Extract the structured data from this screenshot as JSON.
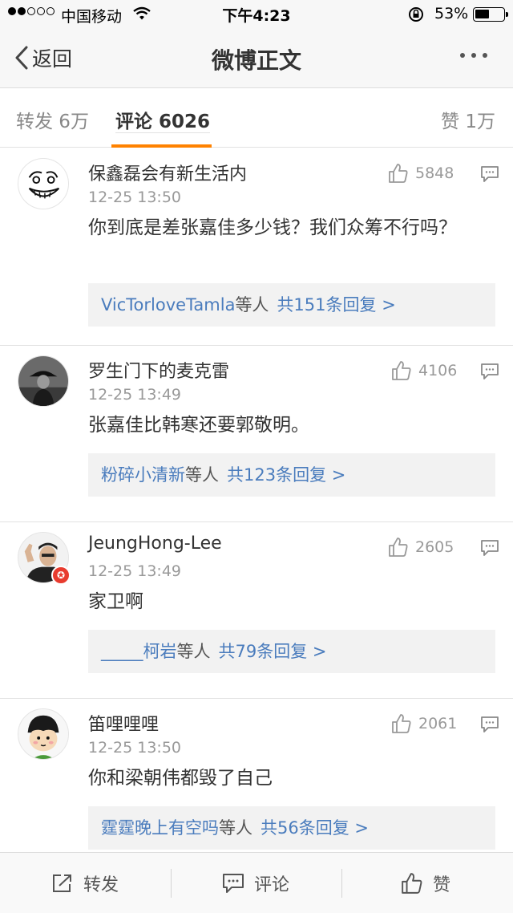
{
  "status_bar": {
    "carrier": "中国移动",
    "time": "下午4:23",
    "battery_percent_text": "53%",
    "battery_level": 0.53,
    "signal_bars_filled": 2,
    "signal_bars_total": 5
  },
  "nav": {
    "back_label": "返回",
    "title": "微博正文"
  },
  "tabs": {
    "repost": "转发 6万",
    "comment": "评论 6026",
    "like": "赞 1万",
    "accent_color": "#ff8200"
  },
  "comments": [
    {
      "username": "保鑫磊会有新生活内",
      "time": "12-25 13:50",
      "likes": "5848",
      "text": "你到底是差张嘉佳多少钱？我们众筹不行吗？",
      "reply_names": "VicTorloveTamla",
      "reply_mid": "等人",
      "reply_count": "共151条回复 >",
      "avatar_icon": "rage-face-avatar"
    },
    {
      "username": "罗生门下的麦克雷",
      "time": "12-25 13:49",
      "likes": "4106",
      "text": "张嘉佳比韩寒还要郭敬明。",
      "reply_names": "粉碎小清新",
      "reply_mid": "等人",
      "reply_count": "共123条回复 >",
      "avatar_icon": "cowboy-avatar"
    },
    {
      "username": "JeungHong-Lee",
      "time": "12-25 13:49",
      "likes": "2605",
      "text": "家卫啊",
      "reply_names": "_____柯岩",
      "reply_mid": "等人",
      "reply_count": "共79条回复 >",
      "avatar_icon": "person-thumb-avatar",
      "verified_badge": "vip-star-badge"
    },
    {
      "username": "笛哩哩哩",
      "time": "12-25 13:50",
      "likes": "2061",
      "text": "你和梁朝伟都毁了自己",
      "reply_names": "霆霆晚上有空吗",
      "reply_mid": "等人",
      "reply_count": "共56条回复 >",
      "avatar_icon": "cartoon-boy-avatar"
    }
  ],
  "toolbar": {
    "repost": "转发",
    "comment": "评论",
    "like": "赞"
  },
  "colors": {
    "link_blue": "#4a7cbd",
    "meta_gray": "#999999",
    "badge_red": "#e83b2e"
  }
}
